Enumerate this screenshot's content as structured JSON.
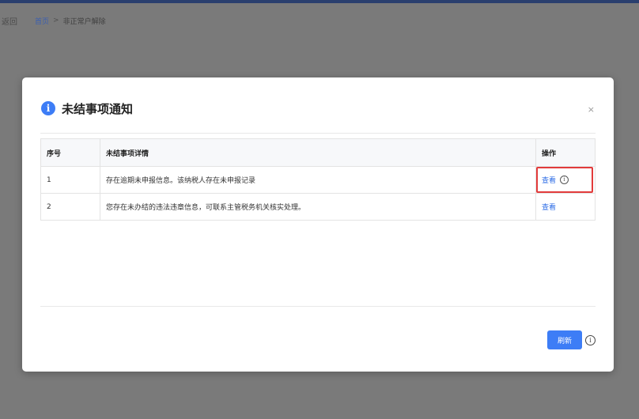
{
  "page": {
    "back_label": "返回",
    "breadcrumb_home": "首页",
    "breadcrumb_sep": ">",
    "breadcrumb_current": "非正常户解除"
  },
  "modal": {
    "title": "未结事项通知",
    "close_label": "×",
    "columns": {
      "no": "序号",
      "detail": "未结事项详情",
      "operation": "操作"
    },
    "rows": [
      {
        "no": "1",
        "detail": "存在逾期未申报信息。该纳税人存在未申报记录",
        "action": "查看"
      },
      {
        "no": "2",
        "detail": "您存在未办结的违法违章信息，可联系主管税务机关核实处理。",
        "action": "查看"
      }
    ],
    "refresh_label": "刷新"
  },
  "icons": {
    "info": "i",
    "tip": "i"
  },
  "colors": {
    "accent": "#3d7df6",
    "highlight": "#e23b3b",
    "link": "#2f6ee6"
  }
}
